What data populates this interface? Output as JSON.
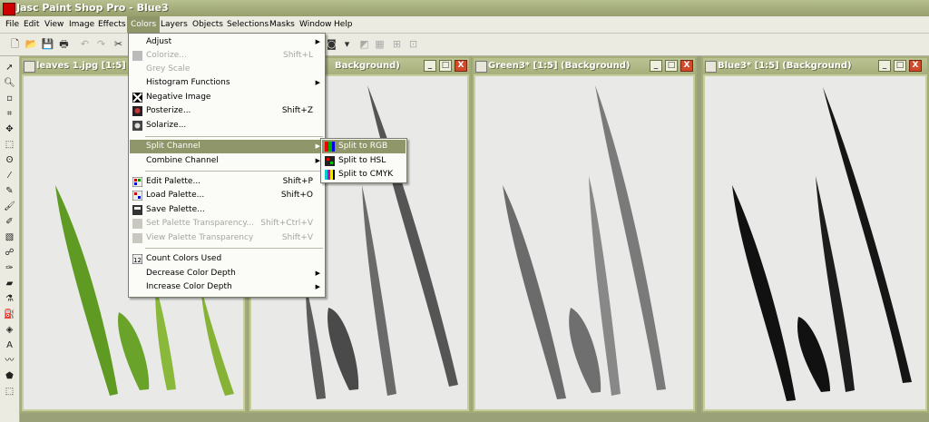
{
  "app": {
    "title": "Jasc Paint Shop Pro - Blue3"
  },
  "menubar": [
    "File",
    "Edit",
    "View",
    "Image",
    "Effects",
    "Colors",
    "Layers",
    "Objects",
    "Selections",
    "Masks",
    "Window",
    "Help"
  ],
  "colors_menu": {
    "group1": [
      {
        "label": "Adjust",
        "shortcut": "",
        "submenu": true,
        "disabled": false
      },
      {
        "label": "Colorize...",
        "shortcut": "Shift+L",
        "submenu": false,
        "disabled": true
      },
      {
        "label": "Grey Scale",
        "shortcut": "",
        "submenu": false,
        "disabled": true
      },
      {
        "label": "Histogram Functions",
        "shortcut": "",
        "submenu": true,
        "disabled": false
      },
      {
        "label": "Negative Image",
        "shortcut": "",
        "submenu": false,
        "disabled": false
      },
      {
        "label": "Posterize...",
        "shortcut": "Shift+Z",
        "submenu": false,
        "disabled": false
      },
      {
        "label": "Solarize...",
        "shortcut": "",
        "submenu": false,
        "disabled": false
      }
    ],
    "group2": [
      {
        "label": "Split Channel",
        "shortcut": "",
        "submenu": true,
        "disabled": false
      },
      {
        "label": "Combine Channel",
        "shortcut": "",
        "submenu": true,
        "disabled": false
      }
    ],
    "group3": [
      {
        "label": "Edit Palette...",
        "shortcut": "Shift+P",
        "submenu": false,
        "disabled": false
      },
      {
        "label": "Load Palette...",
        "shortcut": "Shift+O",
        "submenu": false,
        "disabled": false
      },
      {
        "label": "Save Palette...",
        "shortcut": "",
        "submenu": false,
        "disabled": false
      },
      {
        "label": "Set Palette Transparency...",
        "shortcut": "Shift+Ctrl+V",
        "submenu": false,
        "disabled": true
      },
      {
        "label": "View Palette Transparency",
        "shortcut": "Shift+V",
        "submenu": false,
        "disabled": true
      }
    ],
    "group4": [
      {
        "label": "Count Colors Used",
        "shortcut": "",
        "submenu": false,
        "disabled": false
      },
      {
        "label": "Decrease Color Depth",
        "shortcut": "",
        "submenu": true,
        "disabled": false
      },
      {
        "label": "Increase Color Depth",
        "shortcut": "",
        "submenu": true,
        "disabled": false
      }
    ]
  },
  "split_submenu": [
    "Split to RGB",
    "Split to HSL",
    "Split to CMYK"
  ],
  "windows": [
    {
      "title": "leaves 1.jpg [1:5]"
    },
    {
      "title": "Background)"
    },
    {
      "title": "Green3* [1:5] (Background)"
    },
    {
      "title": "Blue3* [1:5] (Background)"
    }
  ],
  "window_buttons": {
    "minimize": "_",
    "maximize": "□",
    "close": "X"
  },
  "colors": {
    "accent": "#8e966a",
    "title_olive": "#a2ab79",
    "leaf_green": "#6f9f2a",
    "close_red": "#d24a2a"
  }
}
